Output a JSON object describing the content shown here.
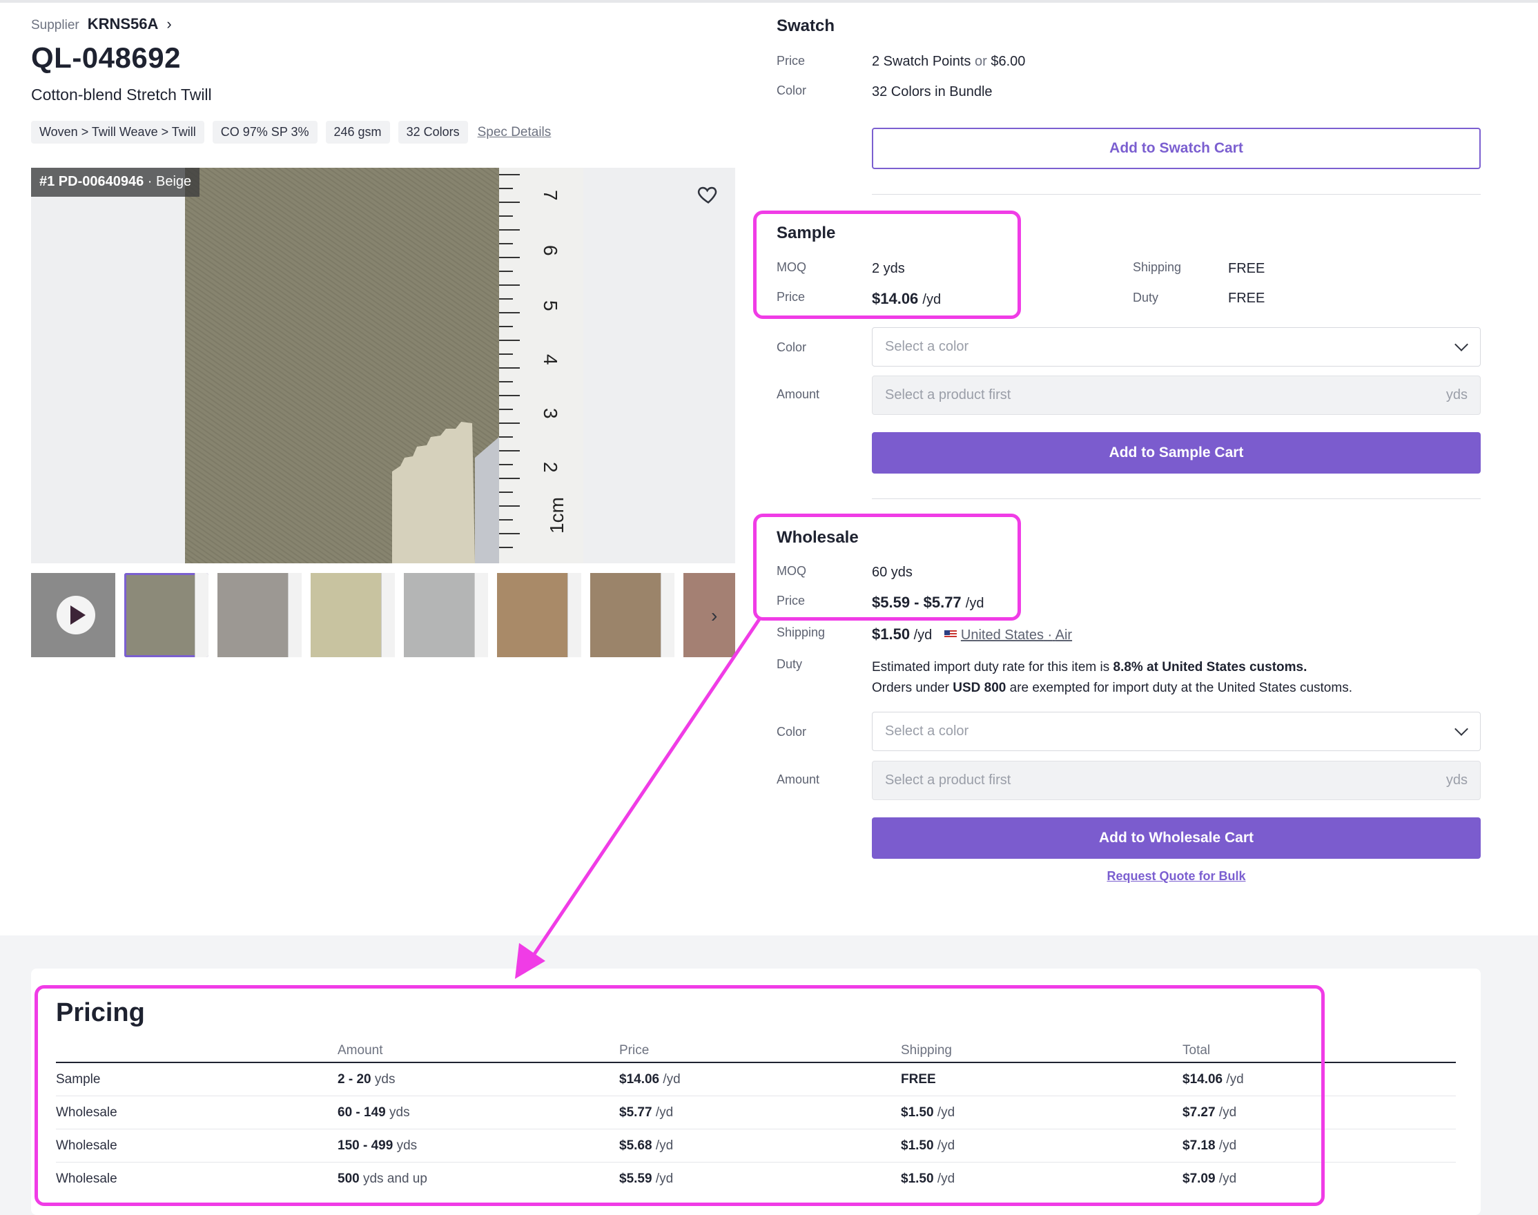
{
  "supplier": {
    "label": "Supplier",
    "name": "KRNS56A",
    "chevron": "chevron-right-icon"
  },
  "product": {
    "code": "QL-048692",
    "name": "Cotton-blend Stretch Twill",
    "tags": [
      "Woven > Twill Weave > Twill",
      "CO 97% SP 3%",
      "246 gsm",
      "32 Colors"
    ],
    "spec_link": "Spec Details"
  },
  "image": {
    "badge_index": "#1 PD-00640946",
    "badge_color": "· Beige",
    "favorite_icon": "heart-icon",
    "ruler_numbers": [
      "7",
      "6",
      "5",
      "4",
      "3",
      "2",
      "1cm"
    ],
    "thumbnails": [
      {
        "kind": "video",
        "color": "#8a8a8a"
      },
      {
        "kind": "image",
        "color": "#8c8a79",
        "selected": true
      },
      {
        "kind": "image",
        "color": "#9c9893"
      },
      {
        "kind": "image",
        "color": "#c8c3a0"
      },
      {
        "kind": "image",
        "color": "#b4b5b5"
      },
      {
        "kind": "image",
        "color": "#a98a68"
      },
      {
        "kind": "image",
        "color": "#9b846a"
      },
      {
        "kind": "image",
        "color": "#a48073"
      }
    ],
    "next_icon": "chevron-right-icon"
  },
  "swatch": {
    "title": "Swatch",
    "price_label": "Price",
    "price_points": "2 Swatch Points",
    "price_or": "or",
    "price_amount": "$6.00",
    "color_label": "Color",
    "color_value": "32 Colors in Bundle",
    "button": "Add to Swatch Cart"
  },
  "sample": {
    "title": "Sample",
    "moq_label": "MOQ",
    "moq_value": "2 yds",
    "price_label": "Price",
    "price_value": "$14.06",
    "price_unit": "/yd",
    "shipping_label": "Shipping",
    "shipping_value": "FREE",
    "duty_label": "Duty",
    "duty_value": "FREE",
    "color_label": "Color",
    "color_placeholder": "Select a color",
    "amount_label": "Amount",
    "amount_placeholder": "Select a product first",
    "amount_unit": "yds",
    "button": "Add to Sample Cart"
  },
  "wholesale": {
    "title": "Wholesale",
    "moq_label": "MOQ",
    "moq_value": "60 yds",
    "price_label": "Price",
    "price_value": "$5.59 - $5.77",
    "price_unit": "/yd",
    "shipping_label": "Shipping",
    "shipping_value": "$1.50",
    "shipping_unit": "/yd",
    "shipping_country": "United States",
    "shipping_sep": "·",
    "shipping_method": "Air",
    "duty_label": "Duty",
    "duty_line1_pre": "Estimated import duty rate for this item is",
    "duty_line1_bold": "8.8% at United States customs.",
    "duty_line2_pre": "Orders under",
    "duty_line2_bold": "USD 800",
    "duty_line2_post": "are exempted for import duty at the United States customs.",
    "color_label": "Color",
    "color_placeholder": "Select a color",
    "amount_label": "Amount",
    "amount_placeholder": "Select a product first",
    "amount_unit": "yds",
    "button": "Add to Wholesale Cart",
    "quote_link": "Request Quote for Bulk"
  },
  "pricing": {
    "title": "Pricing",
    "headers": [
      "",
      "Amount",
      "Price",
      "Shipping",
      "Total"
    ],
    "rows": [
      {
        "type": "Sample",
        "amount": "2 - 20",
        "amount_unit": "yds",
        "price": "$14.06",
        "price_unit": "/yd",
        "shipping": "FREE",
        "shipping_unit": "",
        "total": "$14.06",
        "total_unit": "/yd"
      },
      {
        "type": "Wholesale",
        "amount": "60 - 149",
        "amount_unit": "yds",
        "price": "$5.77",
        "price_unit": "/yd",
        "shipping": "$1.50",
        "shipping_unit": "/yd",
        "total": "$7.27",
        "total_unit": "/yd"
      },
      {
        "type": "Wholesale",
        "amount": "150 - 499",
        "amount_unit": "yds",
        "price": "$5.68",
        "price_unit": "/yd",
        "shipping": "$1.50",
        "shipping_unit": "/yd",
        "total": "$7.18",
        "total_unit": "/yd"
      },
      {
        "type": "Wholesale",
        "amount": "500",
        "amount_unit": "yds and up",
        "price": "$5.59",
        "price_unit": "/yd",
        "shipping": "$1.50",
        "shipping_unit": "/yd",
        "total": "$7.09",
        "total_unit": "/yd"
      }
    ]
  },
  "colors": {
    "accent": "#7b5cce",
    "highlight": "#f03ce6",
    "text": "#1e2230",
    "muted": "#6d7280"
  }
}
